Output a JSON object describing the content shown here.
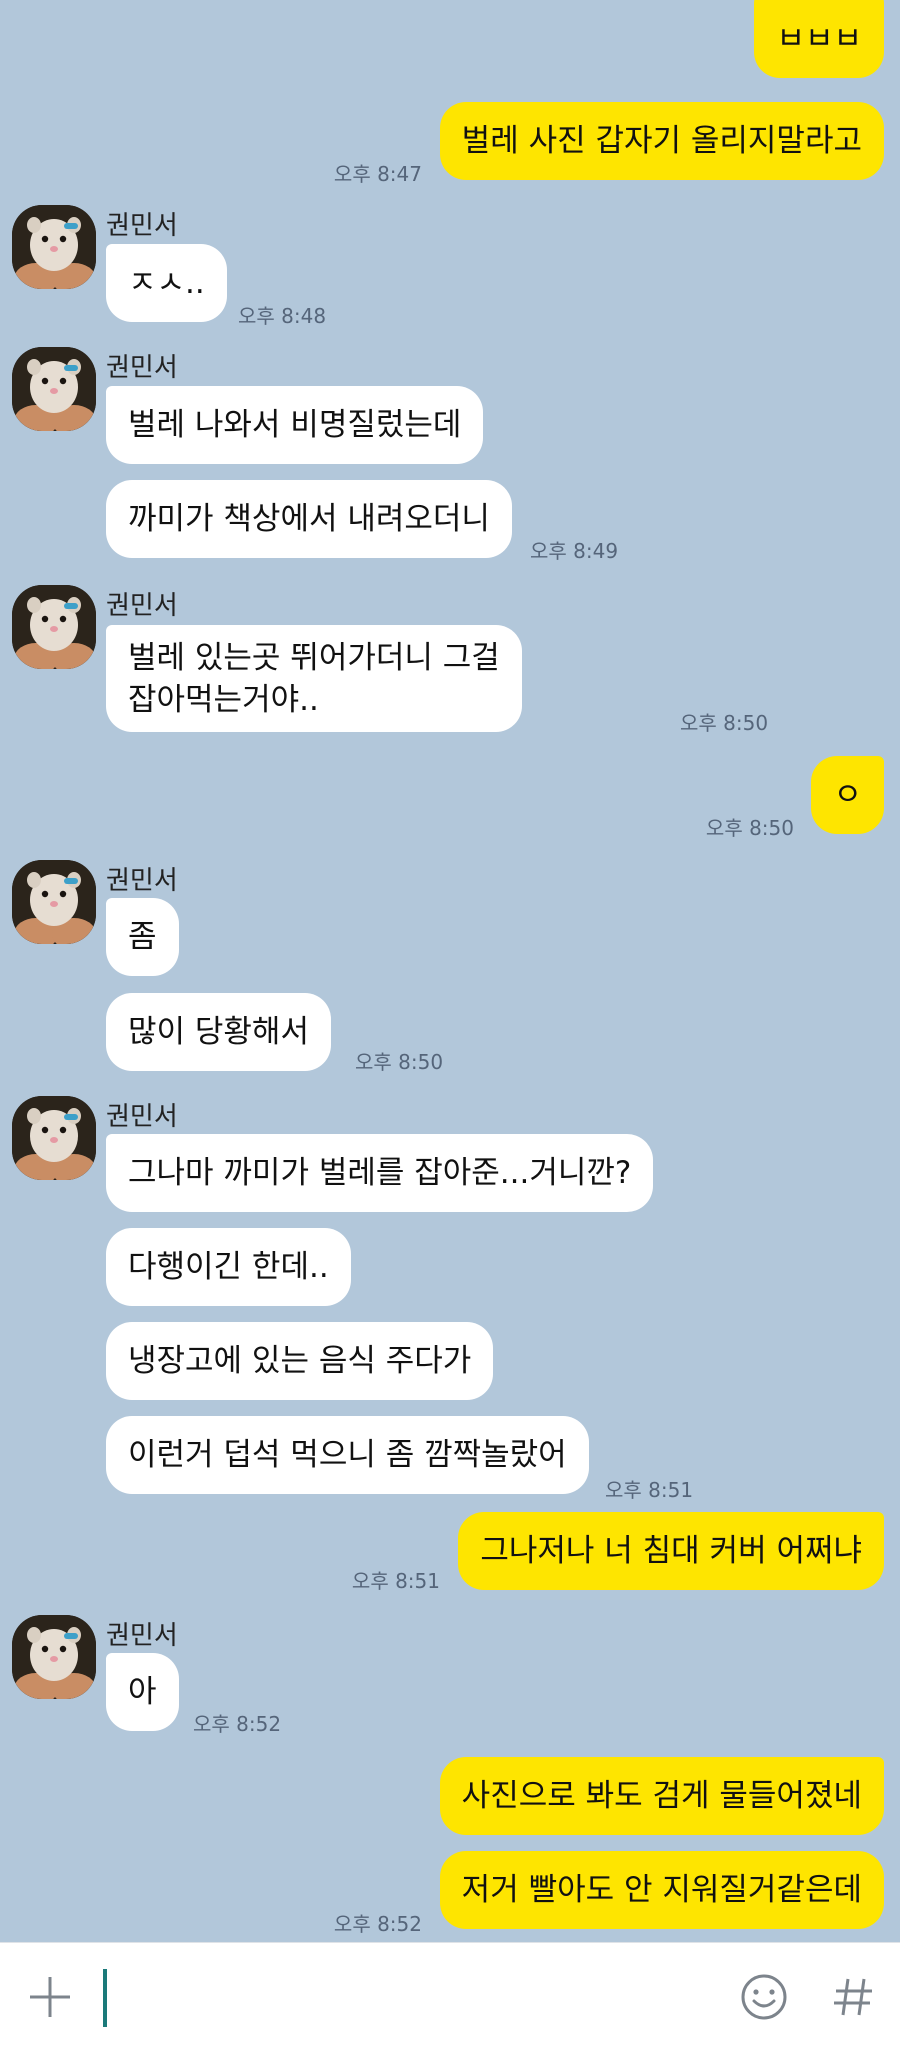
{
  "contact": {
    "name": "권민서",
    "avatar_icon": "hamster-avatar-icon"
  },
  "messages": [
    {
      "text": "ㅂㅂㅂ",
      "side": "mine"
    },
    {
      "text": "벌레 사진 갑자기 올리지말라고",
      "side": "mine",
      "time": "오후 8:47"
    },
    {
      "text": "ㅈㅅ..",
      "side": "theirs",
      "time": "오후 8:48"
    },
    {
      "text": "벌레 나와서 비명질렀는데",
      "side": "theirs"
    },
    {
      "text": "까미가 책상에서 내려오더니",
      "side": "theirs",
      "time": "오후 8:49"
    },
    {
      "text": "벌레 있는곳 뛰어가더니 그걸\n잡아먹는거야..",
      "side": "theirs",
      "time": "오후 8:50"
    },
    {
      "text": "ㅇ",
      "side": "mine",
      "time": "오후 8:50"
    },
    {
      "text": "좀",
      "side": "theirs"
    },
    {
      "text": "많이 당황해서",
      "side": "theirs",
      "time": "오후 8:50"
    },
    {
      "text": "그나마 까미가 벌레를 잡아준...거니깐?",
      "side": "theirs"
    },
    {
      "text": "다행이긴 한데..",
      "side": "theirs"
    },
    {
      "text": "냉장고에 있는 음식 주다가",
      "side": "theirs"
    },
    {
      "text": "이런거 덥석 먹으니 좀 깜짝놀랐어",
      "side": "theirs",
      "time": "오후 8:51"
    },
    {
      "text": "그나저나 너 침대 커버 어쩌냐",
      "side": "mine",
      "time": "오후 8:51"
    },
    {
      "text": "아",
      "side": "theirs",
      "time": "오후 8:52"
    },
    {
      "text": "사진으로 봐도 검게 물들어졌네",
      "side": "mine"
    },
    {
      "text": "저거 빨아도 안 지워질거같은데",
      "side": "mine",
      "time": "오후 8:52"
    }
  ],
  "input_bar": {
    "value": "",
    "icons": [
      "plus-icon",
      "emoji-icon",
      "hashtag-icon"
    ]
  },
  "colors": {
    "background": "#b2c7da",
    "mine": "#fee500",
    "theirs": "#ffffff"
  }
}
